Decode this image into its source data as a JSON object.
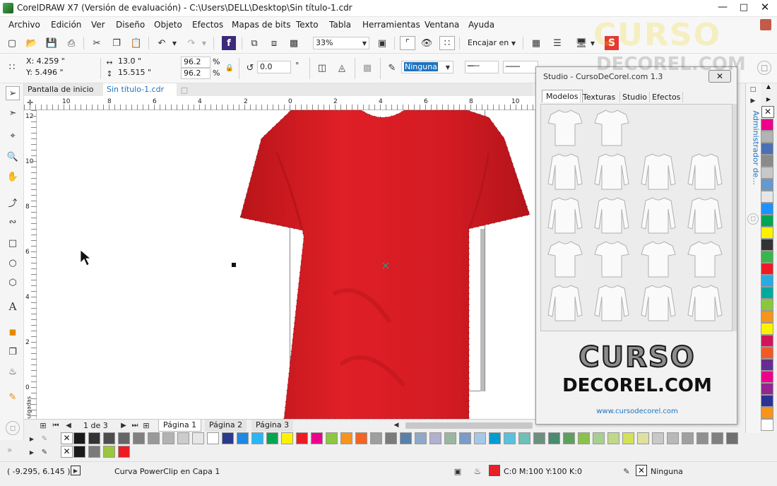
{
  "window": {
    "title": "CorelDRAW X7 (Versión de evaluación) - C:\\Users\\DELL\\Desktop\\Sin título-1.cdr"
  },
  "menu": [
    "Archivo",
    "Edición",
    "Ver",
    "Diseño",
    "Objeto",
    "Efectos",
    "Mapas de bits",
    "Texto",
    "Tabla",
    "Herramientas",
    "Ventana",
    "Ayuda"
  ],
  "toolbar": {
    "zoom": "33%",
    "snap_label": "Encajar en"
  },
  "propbar": {
    "x": "X: 4.259 \"",
    "y": "Y: 5.496 \"",
    "width": "13.0 \"",
    "height": "15.515 \"",
    "scale_w": "96.2",
    "scale_h": "96.2",
    "pct1": "%",
    "pct2": "%",
    "rotation": "0.0",
    "deg": "°",
    "outline": "Ninguna"
  },
  "doc_tabs": [
    "Pantalla de inicio",
    "Sin título-1.cdr"
  ],
  "ruler_h": [
    "10",
    "8",
    "6",
    "4",
    "2",
    "0",
    "2",
    "4",
    "6",
    "8",
    "10"
  ],
  "ruler_v": [
    "12",
    "10",
    "8",
    "6",
    "4",
    "2",
    "0"
  ],
  "ruler_unit": "pulgadas",
  "pages": {
    "counter": "1 de 3",
    "tabs": [
      "Página 1",
      "Página 2",
      "Página 3"
    ]
  },
  "docker": {
    "title": "Studio - CursoDeCorel.com 1.3",
    "tabs": [
      "Modelos",
      "Texturas",
      "Studio",
      "Efectos"
    ],
    "logo_line1": "CURSO",
    "logo_line2": "DECOREL.COM",
    "url": "www.cursodecorel.com"
  },
  "right_panel_label": "Administrador de...",
  "status": {
    "coords": "( -9.295, 6.145 )",
    "message": "Curva PowerClip en Capa 1",
    "fill": "C:0 M:100 Y:100 K:0",
    "outline": "Ninguna"
  },
  "watermark": {
    "line1": "CURSO",
    "line2": "DECOREL.COM"
  },
  "colors": {
    "fill_red": "#e8202a",
    "accent": "#1e73be"
  },
  "palette_row1": [
    "#1a1a1a",
    "#333333",
    "#4d4d4d",
    "#666666",
    "#808080",
    "#999999",
    "#b3b3b3",
    "#cccccc",
    "#e6e6e6",
    "#ffffff",
    "#2a3a8c",
    "#1e88e5",
    "#29b6f6",
    "#00a651",
    "#fff200",
    "#ed1c24",
    "#ec008c",
    "#8dc63f",
    "#f7941d",
    "#f26522",
    "#9e9e9e",
    "#7b7b7b",
    "#5a7fa8",
    "#8fa8c8",
    "#b0b0d0",
    "#9bb7a0",
    "#7a9cc6",
    "#a5c8e8",
    "#009dcf",
    "#5bc0de",
    "#6dbfb8",
    "#6b9080",
    "#4a8a6e",
    "#5e9f5e",
    "#8bc34a",
    "#a8d08d",
    "#c0d88a",
    "#d4e157",
    "#e0e0a0",
    "#c8c8c8",
    "#b8b8b8",
    "#a0a0a0",
    "#909090",
    "#808080",
    "#707070"
  ],
  "palette_row2": [
    "#1a1a1a",
    "#7a7a7a",
    "#9bc53d",
    "#ed1c24"
  ],
  "right_palette": [
    "#ec008c",
    "#b3b3b3",
    "#4d6fb3",
    "#8a8a8a",
    "#c8c8c8",
    "#6699cc",
    "#e6e6e6",
    "#1e90ff",
    "#00a651",
    "#fff200",
    "#333333",
    "#39b54a",
    "#ed1c24",
    "#29abe2",
    "#00a99d",
    "#8cc63f",
    "#f7941d",
    "#fff200",
    "#d4145a",
    "#f15a24",
    "#662d91",
    "#ec008c",
    "#92278f",
    "#2e3192",
    "#f7941d",
    "#ffffff"
  ]
}
